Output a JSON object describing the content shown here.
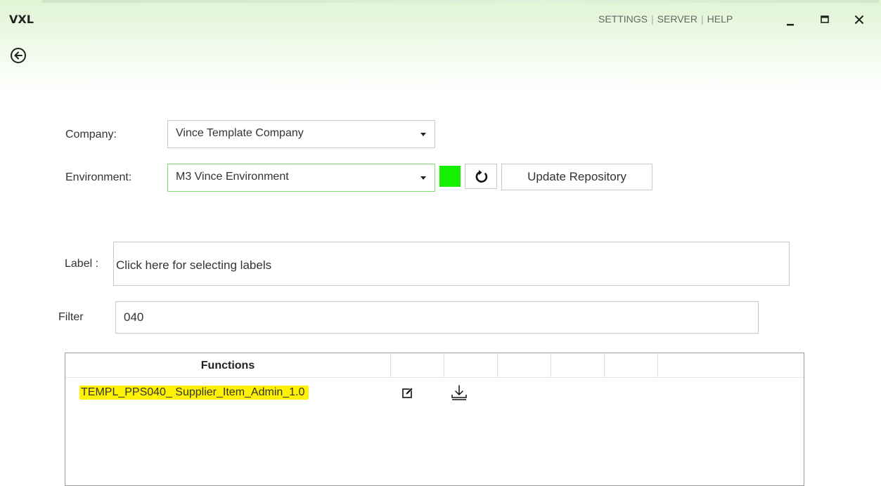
{
  "app": {
    "title": "VXL"
  },
  "topnav": {
    "settings": "SETTINGS",
    "server": "SERVER",
    "help": "HELP",
    "separator": "|"
  },
  "icons": {
    "back": "arrow-left-circle-icon",
    "minimize": "minimize-icon",
    "maximize": "maximize-icon",
    "close": "close-icon",
    "refresh": "refresh-icon",
    "edit": "edit-icon",
    "download": "download-icon",
    "dropdown": "chevron-down-icon"
  },
  "form": {
    "company_label": "Company:",
    "company_value": "Vince Template Company",
    "environment_label": "Environment:",
    "environment_value": "M3 Vince Environment",
    "environment_status_color": "#14f000",
    "update_button": "Update Repository",
    "label_label": "Label :",
    "label_placeholder": "Click here for selecting labels",
    "filter_label": "Filter",
    "filter_value": "040"
  },
  "grid": {
    "columns": [
      "Functions",
      "",
      "",
      "",
      "",
      ""
    ],
    "rows": [
      {
        "function": "TEMPL_PPS040_ Supplier_Item_Admin_1.0",
        "highlight_color": "#fff200"
      }
    ]
  },
  "colors": {
    "header_green": "#dff5d4",
    "accent_green": "#7fdc6f"
  }
}
